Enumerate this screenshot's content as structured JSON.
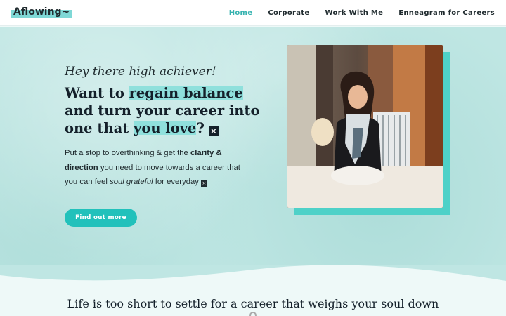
{
  "header": {
    "logo": "Aflowing~",
    "nav": [
      {
        "label": "Home",
        "active": true
      },
      {
        "label": "Corporate",
        "active": false
      },
      {
        "label": "Work With Me",
        "active": false
      },
      {
        "label": "Enneagram for Careers",
        "active": false
      }
    ]
  },
  "hero": {
    "greeting": "Hey there high achiever!",
    "headline": {
      "part1": "Want to ",
      "highlight1": "regain balance",
      "part2": " and turn your career into one that ",
      "highlight2": "you love",
      "part3": "?"
    },
    "body": {
      "t1": "Put a stop to overthinking & get the ",
      "b1": "clarity & direction",
      "t2": " you need to move towards a career that you can feel ",
      "i1": "soul grateful",
      "t3": " for everyday"
    },
    "cta_label": "Find out more"
  },
  "tagline": "Life is too short to settle for a career that weighs your soul down",
  "colors": {
    "accent": "#22c1bb",
    "nav_active": "#37b3b0",
    "highlight": "#8fe0dc",
    "hero_bg": "#bfe6e3",
    "section_bg": "#eef9f8"
  },
  "icons": [
    "missing-glyph-icon"
  ]
}
